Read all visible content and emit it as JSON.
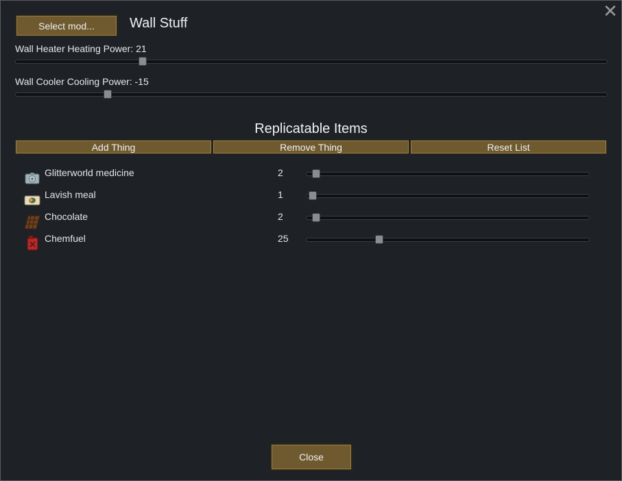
{
  "window": {
    "title": "Wall Stuff",
    "select_mod_label": "Select mod...",
    "close_label": "Close"
  },
  "settings": [
    {
      "label": "Wall Heater Heating Power: 21",
      "fraction": 0.215
    },
    {
      "label": "Wall Cooler Cooling Power: -15",
      "fraction": 0.155
    }
  ],
  "replicatable": {
    "title": "Replicatable Items",
    "buttons": [
      "Add Thing",
      "Remove Thing",
      "Reset List"
    ],
    "items": [
      {
        "name": "Glitterworld medicine",
        "count": "2",
        "icon": "medicine-kit-icon",
        "fraction": 0.033
      },
      {
        "name": "Lavish meal",
        "count": "1",
        "icon": "meal-icon",
        "fraction": 0.023
      },
      {
        "name": "Chocolate",
        "count": "2",
        "icon": "chocolate-icon",
        "fraction": 0.033
      },
      {
        "name": "Chemfuel",
        "count": "25",
        "icon": "fuel-can-icon",
        "fraction": 0.258
      }
    ]
  },
  "colors": {
    "window_bg": "#1e2227",
    "button_bg": "#6f5a30",
    "button_border": "#9a8048",
    "text": "#e6e6e6"
  }
}
